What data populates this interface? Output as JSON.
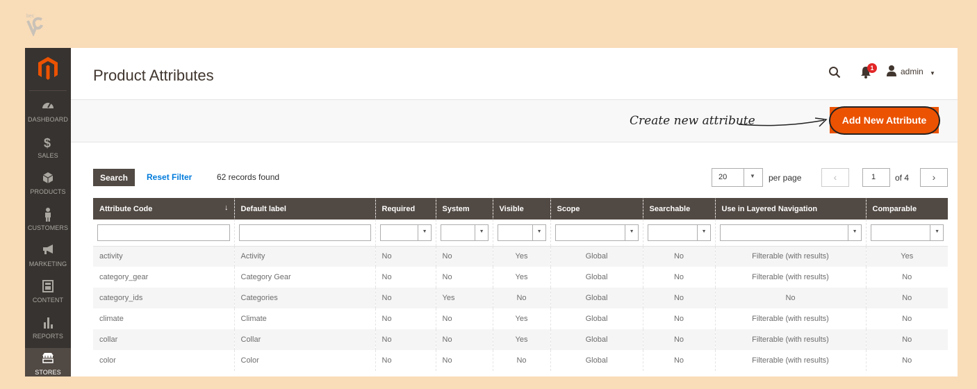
{
  "sidebar": {
    "items": [
      {
        "label": "DASHBOARD",
        "icon": "dashboard-icon"
      },
      {
        "label": "SALES",
        "icon": "dollar-icon"
      },
      {
        "label": "PRODUCTS",
        "icon": "cube-icon"
      },
      {
        "label": "CUSTOMERS",
        "icon": "person-icon"
      },
      {
        "label": "MARKETING",
        "icon": "megaphone-icon"
      },
      {
        "label": "CONTENT",
        "icon": "layout-icon"
      },
      {
        "label": "REPORTS",
        "icon": "bar-chart-icon"
      },
      {
        "label": "STORES",
        "icon": "store-icon"
      }
    ],
    "active": "STORES"
  },
  "header": {
    "title": "Product Attributes",
    "notifications_count": "1",
    "user": "admin"
  },
  "actions": {
    "annotation": "Create new attribute",
    "add_button": "Add New Attribute"
  },
  "toolbar": {
    "search_label": "Search",
    "reset_label": "Reset Filter",
    "records": "62 records found",
    "per_page_value": "20",
    "per_page_label": "per page",
    "page_value": "1",
    "page_of": "of 4"
  },
  "table": {
    "columns": [
      "Attribute Code",
      "Default label",
      "Required",
      "System",
      "Visible",
      "Scope",
      "Searchable",
      "Use in Layered Navigation",
      "Comparable"
    ],
    "rows": [
      [
        "activity",
        "Activity",
        "No",
        "No",
        "Yes",
        "Global",
        "No",
        "Filterable (with results)",
        "Yes"
      ],
      [
        "category_gear",
        "Category Gear",
        "No",
        "No",
        "Yes",
        "Global",
        "No",
        "Filterable (with results)",
        "No"
      ],
      [
        "category_ids",
        "Categories",
        "No",
        "Yes",
        "No",
        "Global",
        "No",
        "No",
        "No"
      ],
      [
        "climate",
        "Climate",
        "No",
        "No",
        "Yes",
        "Global",
        "No",
        "Filterable (with results)",
        "No"
      ],
      [
        "collar",
        "Collar",
        "No",
        "No",
        "Yes",
        "Global",
        "No",
        "Filterable (with results)",
        "No"
      ],
      [
        "color",
        "Color",
        "No",
        "No",
        "No",
        "Global",
        "No",
        "Filterable (with results)",
        "No"
      ]
    ]
  },
  "colors": {
    "accent": "#eb5202",
    "sidebar": "#373330",
    "header_row": "#514943",
    "link": "#007bdb",
    "page_bg": "#f9dcb8"
  }
}
